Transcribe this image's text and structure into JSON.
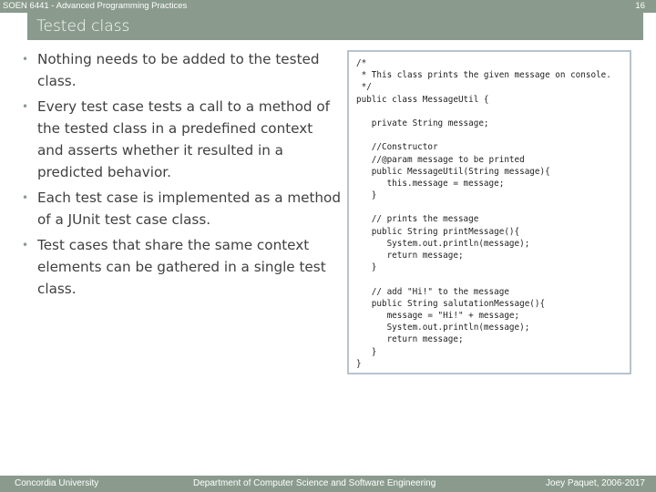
{
  "header": {
    "course": "SOEN 6441 - Advanced Programming Practices",
    "page_number": "16"
  },
  "slide": {
    "title": "Tested class",
    "bullets": [
      "Nothing needs to be added to the tested class.",
      "Every test case tests a call to a method of the tested class in a predefined context and asserts whether it resulted in a predicted behavior.",
      "Each test case is implemented as a method of a JUnit test case class.",
      "Test cases that share the same context elements can be gathered in a single test class."
    ],
    "code_lines": [
      "/*",
      " * This class prints the given message on console.",
      " */",
      "public class MessageUtil {",
      "",
      "   private String message;",
      "",
      "   //Constructor",
      "   //@param message to be printed",
      "   public MessageUtil(String message){",
      "      this.message = message;",
      "   }",
      "",
      "   // prints the message",
      "   public String printMessage(){",
      "      System.out.println(message);",
      "      return message;",
      "   }",
      "",
      "   // add \"Hi!\" to the message",
      "   public String salutationMessage(){",
      "      message = \"Hi!\" + message;",
      "      System.out.println(message);",
      "      return message;",
      "   }",
      "}"
    ]
  },
  "footer": {
    "left": "Concordia University",
    "center": "Department of Computer Science and Software Engineering",
    "right": "Joey Paquet, 2006-2017"
  },
  "colors": {
    "bar": "#8a9b8d",
    "code_border": "#b8c3ce"
  }
}
